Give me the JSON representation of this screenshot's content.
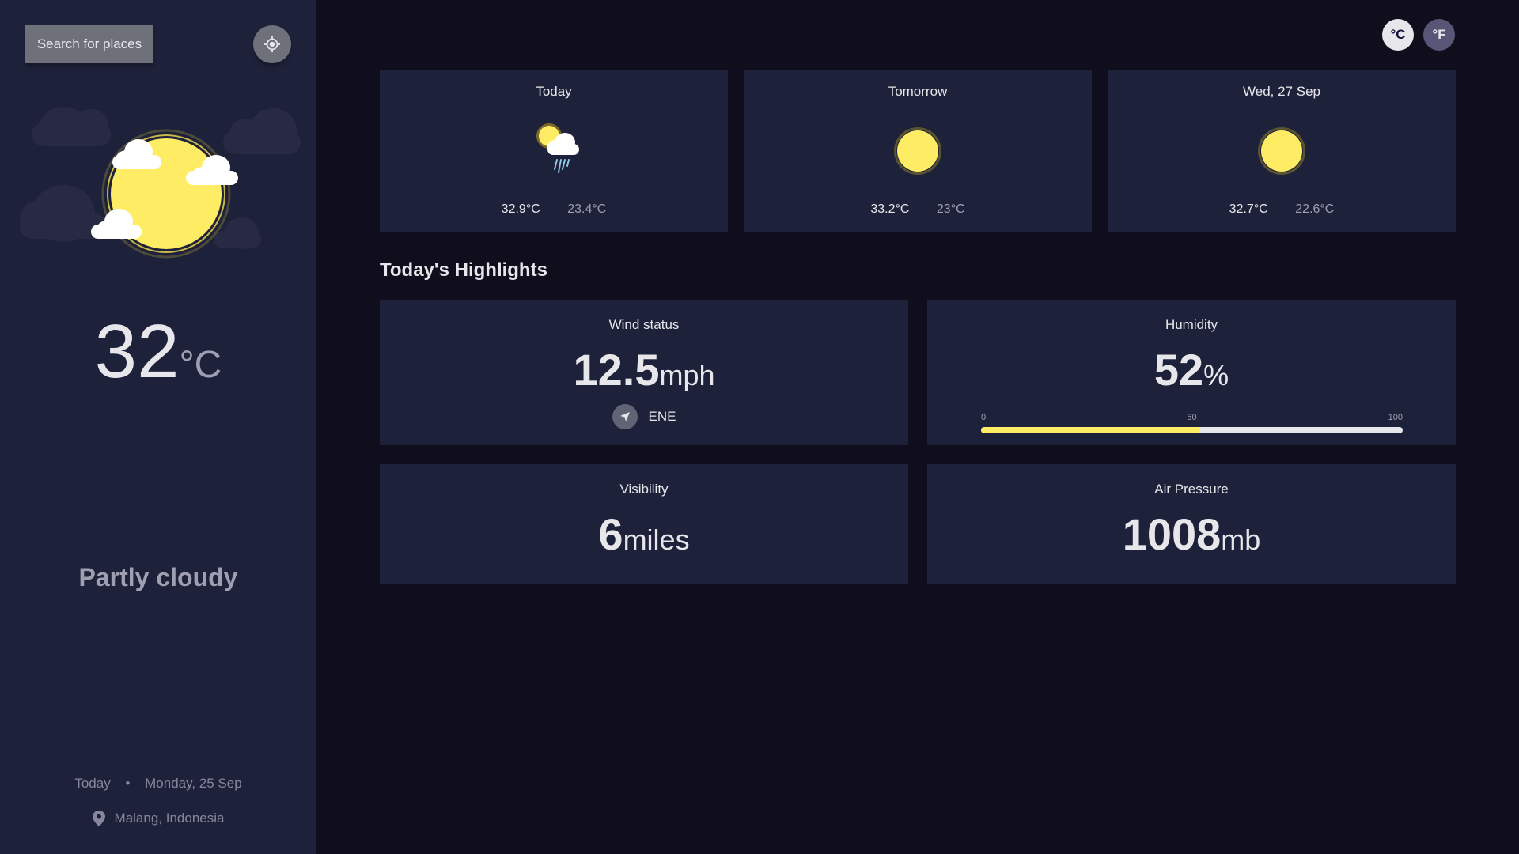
{
  "sidebar": {
    "search_label": "Search for places",
    "locate_icon": "crosshair-icon",
    "temperature": "32",
    "temperature_unit": "°C",
    "condition": "Partly cloudy",
    "date_prefix": "Today",
    "date_separator": "•",
    "date": "Monday, 25 Sep",
    "location": "Malang, Indonesia",
    "location_icon": "location-pin-icon"
  },
  "units": {
    "celsius": "°C",
    "fahrenheit": "°F"
  },
  "forecast": [
    {
      "day": "Today",
      "max": "32.9°C",
      "min": "23.4°C",
      "icon": "sun-cloud-rain-icon"
    },
    {
      "day": "Tomorrow",
      "max": "33.2°C",
      "min": "23°C",
      "icon": "sun-icon"
    },
    {
      "day": "Wed, 27 Sep",
      "max": "32.7°C",
      "min": "22.6°C",
      "icon": "sun-icon"
    }
  ],
  "highlights": {
    "title": "Today's Highlights",
    "wind": {
      "label": "Wind status",
      "value": "12.5",
      "unit": "mph",
      "direction": "ENE",
      "icon": "navigation-arrow-icon"
    },
    "humidity": {
      "label": "Humidity",
      "value": "52",
      "unit": "%",
      "scale_min": "0",
      "scale_mid": "50",
      "scale_max": "100",
      "percent": 52
    },
    "visibility": {
      "label": "Visibility",
      "value": "6",
      "unit": "miles"
    },
    "pressure": {
      "label": "Air Pressure",
      "value": "1008",
      "unit": "mb"
    }
  },
  "colors": {
    "background": "#100e1d",
    "panel": "#1e213a",
    "accent_yellow": "#ffec65",
    "text": "#e7e7eb",
    "muted": "#a09fb1"
  }
}
